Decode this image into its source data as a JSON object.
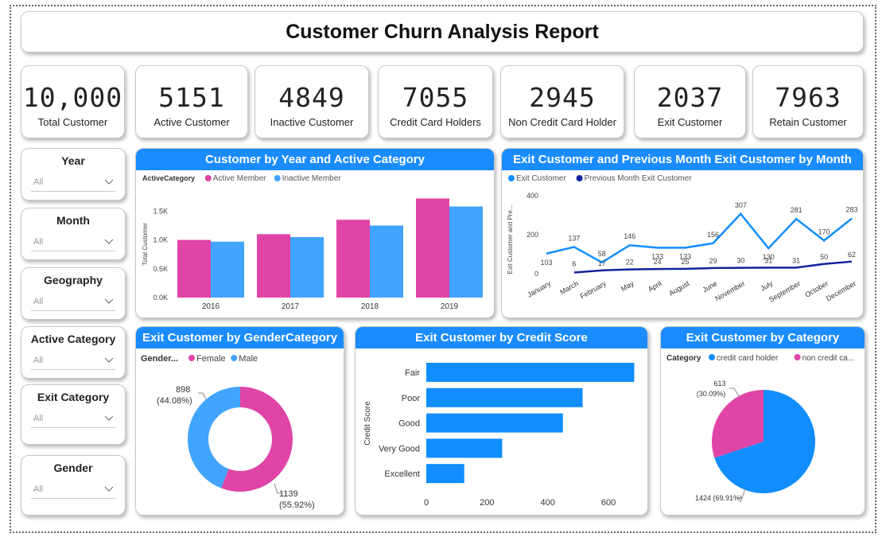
{
  "report_title": "Customer Churn Analysis Report",
  "kpis": [
    {
      "value": "10,000",
      "label": "Total Customer"
    },
    {
      "value": "5151",
      "label": "Active Customer"
    },
    {
      "value": "4849",
      "label": "Inactive Customer"
    },
    {
      "value": "7055",
      "label": "Credit Card Holders"
    },
    {
      "value": "2945",
      "label": "Non Credit Card Holder"
    },
    {
      "value": "2037",
      "label": "Exit Customer"
    },
    {
      "value": "7963",
      "label": "Retain Customer"
    }
  ],
  "slicers": [
    {
      "title": "Year",
      "value": "All"
    },
    {
      "title": "Month",
      "value": "All"
    },
    {
      "title": "Geography",
      "value": "All"
    },
    {
      "title": "Active Category",
      "value": "All"
    },
    {
      "title": "Exit Category",
      "value": "All"
    },
    {
      "title": "Gender",
      "value": "All"
    }
  ],
  "chart_titles": {
    "year_active": "Customer by Year and Active Category",
    "exit_month": "Exit Customer and Previous Month Exit Customer by Month",
    "gender": "Exit Customer by GenderCategory",
    "credit": "Exit Customer by Credit Score",
    "category": "Exit Customer by Category"
  },
  "colors": {
    "pink": "#e044a7",
    "blue": "#41a4ff",
    "line_light": "#118dff",
    "line_dark": "#12239e",
    "header": "#1a8cff"
  },
  "chart_data": [
    {
      "type": "bar",
      "title": "Customer by Year and Active Category",
      "legend_title": "ActiveCategory",
      "categories": [
        "2016",
        "2017",
        "2018",
        "2019"
      ],
      "series": [
        {
          "name": "Active Member",
          "values": [
            1000,
            1100,
            1350,
            1720
          ]
        },
        {
          "name": "Inactive Member",
          "values": [
            970,
            1050,
            1250,
            1580
          ]
        }
      ],
      "ylabel": "Total Customer",
      "yticks": [
        "0.0K",
        "0.5K",
        "1.0K",
        "1.5K"
      ],
      "ylim": [
        0,
        1850
      ]
    },
    {
      "type": "line",
      "title": "Exit Customer and Previous Month Exit Customer by Month",
      "categories": [
        "January",
        "March",
        "February",
        "May",
        "April",
        "August",
        "June",
        "November",
        "July",
        "September",
        "October",
        "December"
      ],
      "series": [
        {
          "name": "Exit Customer",
          "values": [
            103,
            137,
            58,
            146,
            133,
            133,
            156,
            307,
            130,
            281,
            170,
            283
          ]
        },
        {
          "name": "Previous Month Exit Customer",
          "values": [
            null,
            6,
            17,
            22,
            24,
            25,
            29,
            30,
            31,
            31,
            50,
            62
          ]
        }
      ],
      "ylabel": "Exit Customer and Pre...",
      "yticks": [
        "0",
        "200",
        "400"
      ],
      "ylim": [
        0,
        400
      ]
    },
    {
      "type": "pie",
      "title": "Exit Customer by GenderCategory",
      "legend_title": "Gender...",
      "labels": [
        "Female",
        "Male"
      ],
      "values": [
        1139,
        898
      ],
      "percent_labels": [
        "1139 (55.92%)",
        "898 (44.08%)"
      ]
    },
    {
      "type": "bar",
      "orientation": "horizontal",
      "title": "Exit Customer by Credit Score",
      "categories": [
        "Fair",
        "Poor",
        "Good",
        "Very Good",
        "Excellent"
      ],
      "values": [
        685,
        515,
        450,
        250,
        125
      ],
      "ylabel": "Credit Score",
      "xticks": [
        "0",
        "200",
        "400",
        "600"
      ],
      "xlim": [
        0,
        710
      ]
    },
    {
      "type": "pie",
      "title": "Exit Customer by Category",
      "legend_title": "Category",
      "labels": [
        "credit card holder",
        "non credit ca..."
      ],
      "values": [
        1424,
        613
      ],
      "percent_labels": [
        "1424 (69.91%)",
        "613 (30.09%)"
      ]
    }
  ]
}
